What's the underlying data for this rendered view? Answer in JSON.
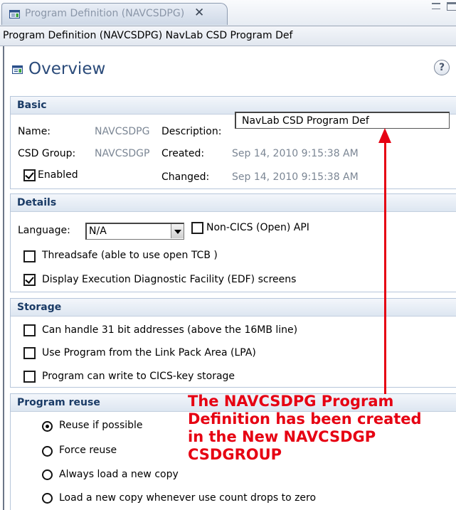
{
  "tab": {
    "title": "Program Definition (NAVCSDPG)",
    "close": "✕"
  },
  "path_title": "Program Definition (NAVCSDPG) NavLab CSD Program Def",
  "header": {
    "title": "Overview",
    "help": "?"
  },
  "basic": {
    "heading": "Basic",
    "name_label": "Name:",
    "name_value": "NAVCSDPG",
    "description_label": "Description:",
    "description_value": "NavLab CSD Program Def",
    "group_label": "CSD Group:",
    "group_value": "NAVCSDGP",
    "created_label": "Created:",
    "created_value": "Sep 14, 2010 9:15:38 AM",
    "enabled_label": "Enabled",
    "enabled_checked": true,
    "changed_label": "Changed:",
    "changed_value": "Sep 14, 2010 9:15:38 AM"
  },
  "details": {
    "heading": "Details",
    "language_label": "Language:",
    "language_value": "N/A",
    "noncics_label": "Non-CICS (Open) API",
    "noncics_checked": false,
    "threadsafe_label": "Threadsafe (able to use open TCB )",
    "threadsafe_checked": false,
    "edf_label": "Display Execution Diagnostic Facility (EDF) screens",
    "edf_checked": true
  },
  "storage": {
    "heading": "Storage",
    "addr31_label": "Can handle 31 bit addresses (above the 16MB line)",
    "addr31_checked": false,
    "lpa_label": "Use Program from the Link Pack Area (LPA)",
    "lpa_checked": false,
    "cicskey_label": "Program can write to CICS-key storage",
    "cicskey_checked": false
  },
  "reuse": {
    "heading": "Program reuse",
    "options": [
      "Reuse if possible",
      "Force reuse",
      "Always load a new copy",
      "Load a new copy whenever use count drops to zero"
    ],
    "selected": "Reuse if possible"
  },
  "annotation": {
    "line1": "The NAVCSDPG Program",
    "line2": "Definition has been created",
    "line3": "in the New NAVCSDGP",
    "line4": "CSDGROUP",
    "color": "#e60012"
  }
}
